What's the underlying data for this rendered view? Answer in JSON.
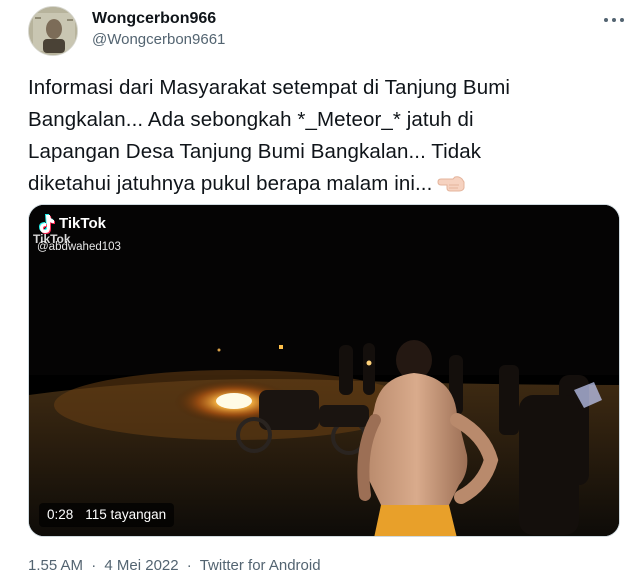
{
  "author": {
    "display_name": "Wongcerbon966",
    "handle": "@Wongcerbon9661",
    "avatar_icon": "profile-photo"
  },
  "more_icon": "more-horizontal-icon",
  "tweet_text_lines": [
    "Informasi dari Masyarakat setempat di Tanjung Bumi",
    "Bangkalan... Ada sebongkah *_Meteor_* jatuh di",
    "Lapangan Desa Tanjung Bumi Bangkalan... Tidak",
    "diketahui jatuhnya pukul berapa malam ini..."
  ],
  "emoji": "pointing-left-hand",
  "video": {
    "watermark_brand": "TikTok",
    "watermark_brand_small": "TikTok",
    "watermark_user": "@abdwahed103",
    "duration": "0:28",
    "views": "115 tayangan"
  },
  "meta": {
    "time": "1.55 AM",
    "date": "4 Mei 2022",
    "source": "Twitter for Android",
    "separator": "·"
  },
  "colors": {
    "text": "#0f1419",
    "secondary": "#536471",
    "fire": "#ffb347"
  }
}
